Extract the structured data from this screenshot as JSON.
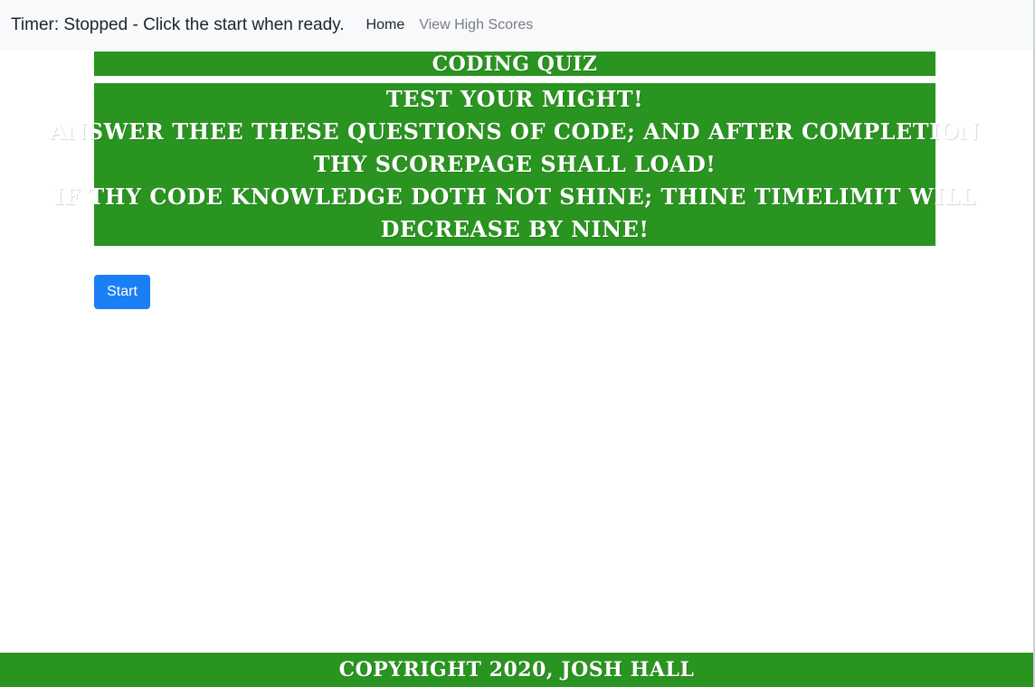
{
  "navbar": {
    "timer_text": "Timer: Stopped - Click the start when ready.",
    "links": [
      {
        "label": "Home",
        "active": true
      },
      {
        "label": "View High Scores",
        "active": false
      }
    ]
  },
  "quiz": {
    "title": "Coding Quiz",
    "intro_lines": [
      "Test your might!",
      "Answer thee these questions of code; and after completion",
      "thy scorepage shall load!",
      "If thy code knowledge doth not shine; thine timelimit will",
      "decrease by nine!"
    ],
    "start_label": "Start"
  },
  "footer": {
    "text": "Copyright 2020, Josh Hall"
  },
  "colors": {
    "banner_green": "#2a9420",
    "button_blue": "#1a7ff5",
    "navbar_bg": "#f8f9fa"
  }
}
